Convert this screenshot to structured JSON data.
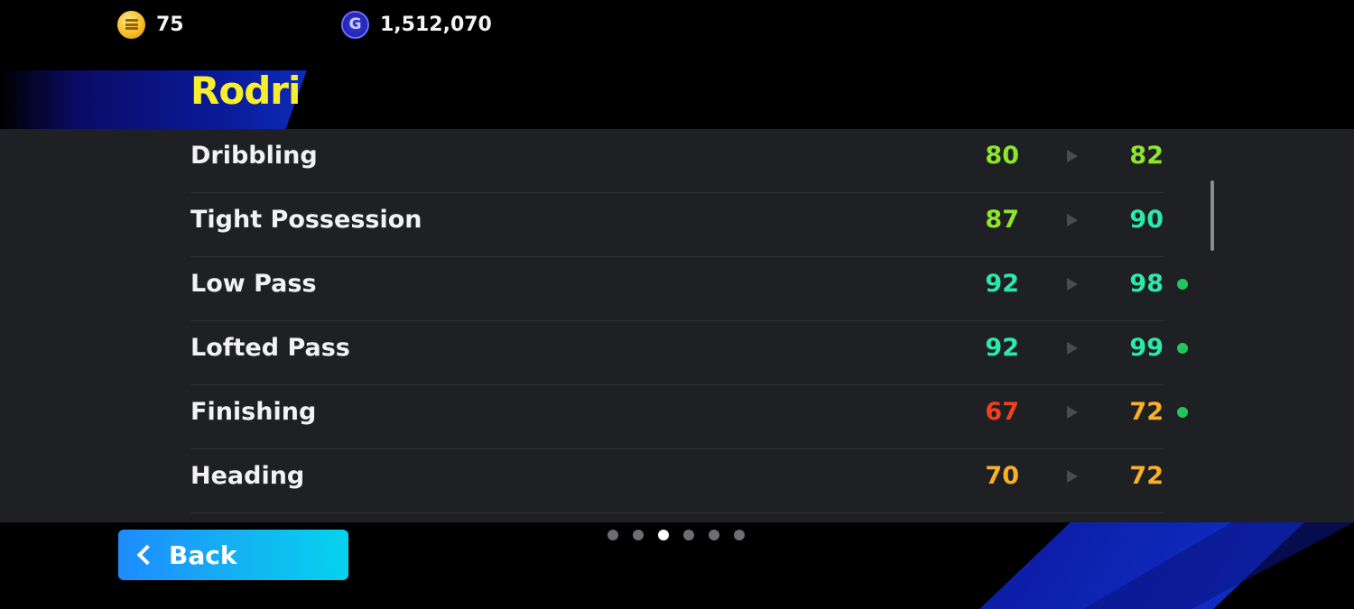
{
  "header": {
    "coins": {
      "icon": "coin-icon",
      "value": "75"
    },
    "gp": {
      "icon": "gp-icon",
      "symbol": "G",
      "value": "1,512,070"
    }
  },
  "player": {
    "name": "Rodri"
  },
  "stats": [
    {
      "label": "Dribbling",
      "old": "80",
      "new": "82",
      "old_color": "#8ee52c",
      "new_color": "#8ee52c",
      "boosted": false
    },
    {
      "label": "Tight Possession",
      "old": "87",
      "new": "90",
      "old_color": "#8ee52c",
      "new_color": "#2ee8a6",
      "boosted": false
    },
    {
      "label": "Low Pass",
      "old": "92",
      "new": "98",
      "old_color": "#2ee8a6",
      "new_color": "#2ee8a6",
      "boosted": true
    },
    {
      "label": "Lofted Pass",
      "old": "92",
      "new": "99",
      "old_color": "#2ee8a6",
      "new_color": "#2ee8a6",
      "boosted": true
    },
    {
      "label": "Finishing",
      "old": "67",
      "new": "72",
      "old_color": "#f0401e",
      "new_color": "#f7b027",
      "boosted": true
    },
    {
      "label": "Heading",
      "old": "70",
      "new": "72",
      "old_color": "#f7b027",
      "new_color": "#f7b027",
      "boosted": false
    }
  ],
  "pagination": {
    "total": 6,
    "current": 3
  },
  "footer": {
    "back_label": "Back",
    "back_icon": "chevron-left-icon"
  }
}
